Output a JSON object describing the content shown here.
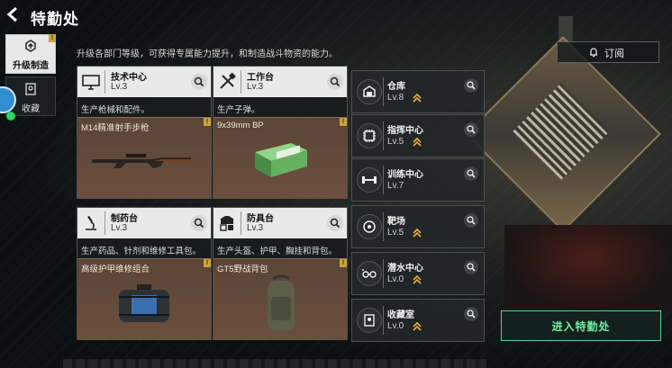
{
  "header": {
    "back_icon": "back-arrow-icon",
    "title": "特勤处"
  },
  "sidebar": {
    "tabs": [
      {
        "label": "升级制造",
        "icon": "upgrade-icon",
        "badge": "!",
        "active": true
      },
      {
        "label": "收藏",
        "icon": "bookmark-icon",
        "active": false
      }
    ]
  },
  "description": "升级各部门等级，可获得专属能力提升，和制造战斗物资的能力。",
  "subscribe": {
    "label": "订阅",
    "icon": "bell-icon"
  },
  "cards": [
    {
      "name": "技术中心",
      "level": "Lv.3",
      "icon": "monitor-icon",
      "desc": "生产枪械和配件。",
      "item": "M14精准射手步枪",
      "badge": "!"
    },
    {
      "name": "工作台",
      "level": "Lv.3",
      "icon": "tools-icon",
      "desc": "生产子弹。",
      "item": "9x39mm BP",
      "badge": "!"
    },
    {
      "name": "制药台",
      "level": "Lv.3",
      "icon": "microscope-icon",
      "desc": "生产药品、针剂和维修工具包。",
      "item": "高级护甲维修组合",
      "badge": "!"
    },
    {
      "name": "防具台",
      "level": "Lv.3",
      "icon": "armor-icon",
      "desc": "生产头盔、护甲、胸挂和背包。",
      "item": "GT5野战背包",
      "badge": "!"
    }
  ],
  "facilities": [
    {
      "name": "仓库",
      "level": "Lv.8",
      "icon": "warehouse-icon",
      "upgradable": true
    },
    {
      "name": "指挥中心",
      "level": "Lv.5",
      "icon": "chip-icon",
      "upgradable": true
    },
    {
      "name": "训练中心",
      "level": "Lv.7",
      "icon": "dumbbell-icon",
      "upgradable": false
    },
    {
      "name": "靶场",
      "level": "Lv.5",
      "icon": "target-icon",
      "upgradable": true
    },
    {
      "name": "潜水中心",
      "level": "Lv.0",
      "icon": "diving-icon",
      "upgradable": true
    },
    {
      "name": "收藏室",
      "level": "Lv.0",
      "icon": "trophy-icon",
      "upgradable": true
    }
  ],
  "enter_button": "进入特勤处",
  "colors": {
    "accent_green": "#6cf0a2",
    "badge_gold": "#c9a43a",
    "item_bg": "#5b4536",
    "upgrade_arrow": "#e3b23c"
  }
}
